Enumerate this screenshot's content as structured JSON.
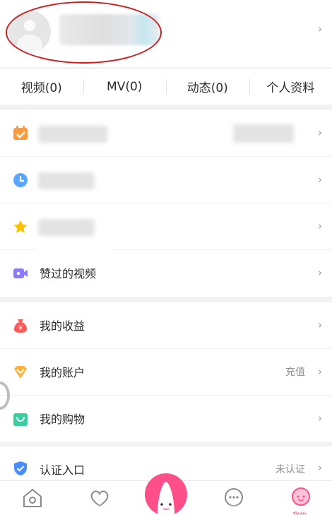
{
  "tabs": [
    {
      "label": "视频(0)"
    },
    {
      "label": "MV(0)"
    },
    {
      "label": "动态(0)"
    },
    {
      "label": "个人资料"
    }
  ],
  "menu_group_1": [
    {
      "icon": "calendar-check-icon",
      "label": ""
    },
    {
      "icon": "clock-icon",
      "label": ""
    },
    {
      "icon": "star-icon",
      "label": ""
    },
    {
      "icon": "video-camera-icon",
      "label": "赞过的视频"
    }
  ],
  "menu_group_2": [
    {
      "icon": "money-bag-icon",
      "label": "我的收益",
      "right": ""
    },
    {
      "icon": "diamond-icon",
      "label": "我的账户",
      "right": "充值"
    },
    {
      "icon": "shopping-bag-icon",
      "label": "我的购物",
      "right": ""
    }
  ],
  "menu_group_3": [
    {
      "icon": "shield-check-icon",
      "label": "认证入口",
      "right": "未认证"
    }
  ],
  "bottom_nav": [
    {
      "icon": "home-icon",
      "label": ""
    },
    {
      "icon": "heart-icon",
      "label": ""
    },
    {
      "icon": "center-create-icon",
      "label": ""
    },
    {
      "icon": "chat-icon",
      "label": ""
    },
    {
      "icon": "profile-face-icon",
      "label": "我的"
    }
  ],
  "colors": {
    "accent_pink": "#ff4f8b",
    "annotation_red": "#d21d1d",
    "text_muted": "#8f8f8f"
  }
}
